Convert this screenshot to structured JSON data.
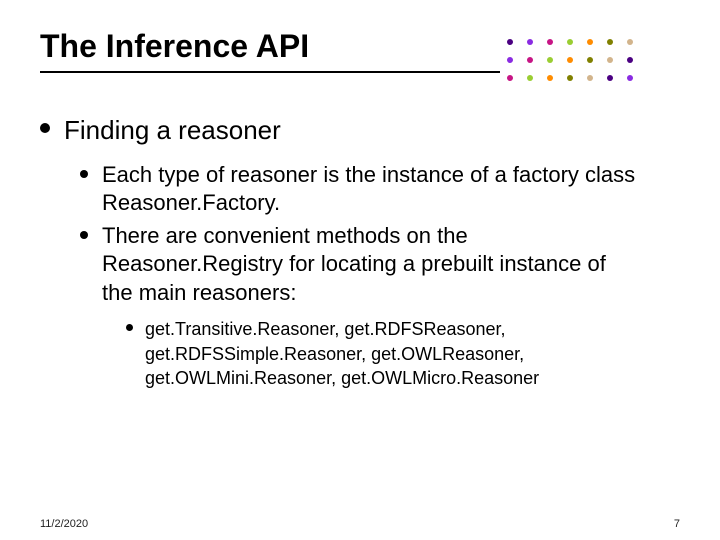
{
  "title": "The Inference API",
  "bullets": {
    "l1": "Finding a reasoner",
    "l2a": "Each type of reasoner is the instance of a factory class Reasoner.Factory.",
    "l2b": "There are convenient methods on the Reasoner.Registry for locating a prebuilt instance of the main reasoners:",
    "l3": "get.Transitive.Reasoner, get.RDFSReasoner, get.RDFSSimple.Reasoner, get.OWLReasoner, get.OWLMini.Reasoner, get.OWLMicro.Reasoner"
  },
  "footer": {
    "date": "11/2/2020",
    "page": "7"
  },
  "decor": {
    "colors": [
      "#4B0082",
      "#8A2BE2",
      "#C71585",
      "#9ACD32",
      "#FF8C00",
      "#808000",
      "#D2B48C"
    ]
  }
}
